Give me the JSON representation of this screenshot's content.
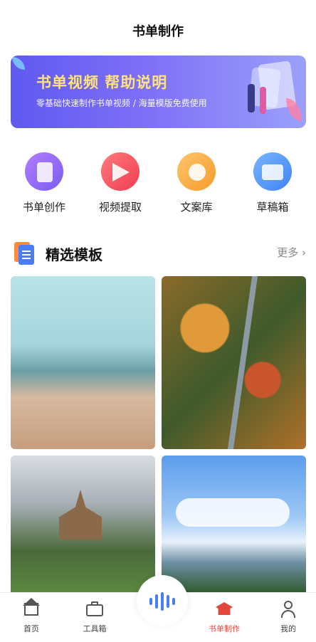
{
  "header": {
    "title": "书单制作"
  },
  "banner": {
    "headline": "书单视频  帮助说明",
    "subtitle": "零基础快速制作书单视频 / 海量模版免费使用"
  },
  "tools": [
    {
      "label": "书单创作",
      "icon": "book-create-icon"
    },
    {
      "label": "视频提取",
      "icon": "video-extract-icon"
    },
    {
      "label": "文案库",
      "icon": "copy-library-icon"
    },
    {
      "label": "草稿箱",
      "icon": "drafts-icon"
    }
  ],
  "section": {
    "title": "精选模板",
    "more": "更多",
    "more_icon": "chevron-right-icon"
  },
  "templates": [
    {
      "icon": "beach-image"
    },
    {
      "icon": "autumn-forest-road-image"
    },
    {
      "icon": "mountain-church-image"
    },
    {
      "icon": "sky-hills-image"
    }
  ],
  "tabbar": {
    "items": [
      {
        "label": "首页",
        "icon": "home-icon",
        "active": false
      },
      {
        "label": "工具箱",
        "icon": "toolbox-icon",
        "active": false
      },
      {
        "label": "书单制作",
        "icon": "graduation-cap-icon",
        "active": true
      },
      {
        "label": "我的",
        "icon": "user-icon",
        "active": false
      }
    ],
    "center_icon": "voice-wave-icon"
  },
  "colors": {
    "accent": "#e2473c",
    "banner_start": "#5f59f0",
    "banner_text": "#ffe27a"
  }
}
